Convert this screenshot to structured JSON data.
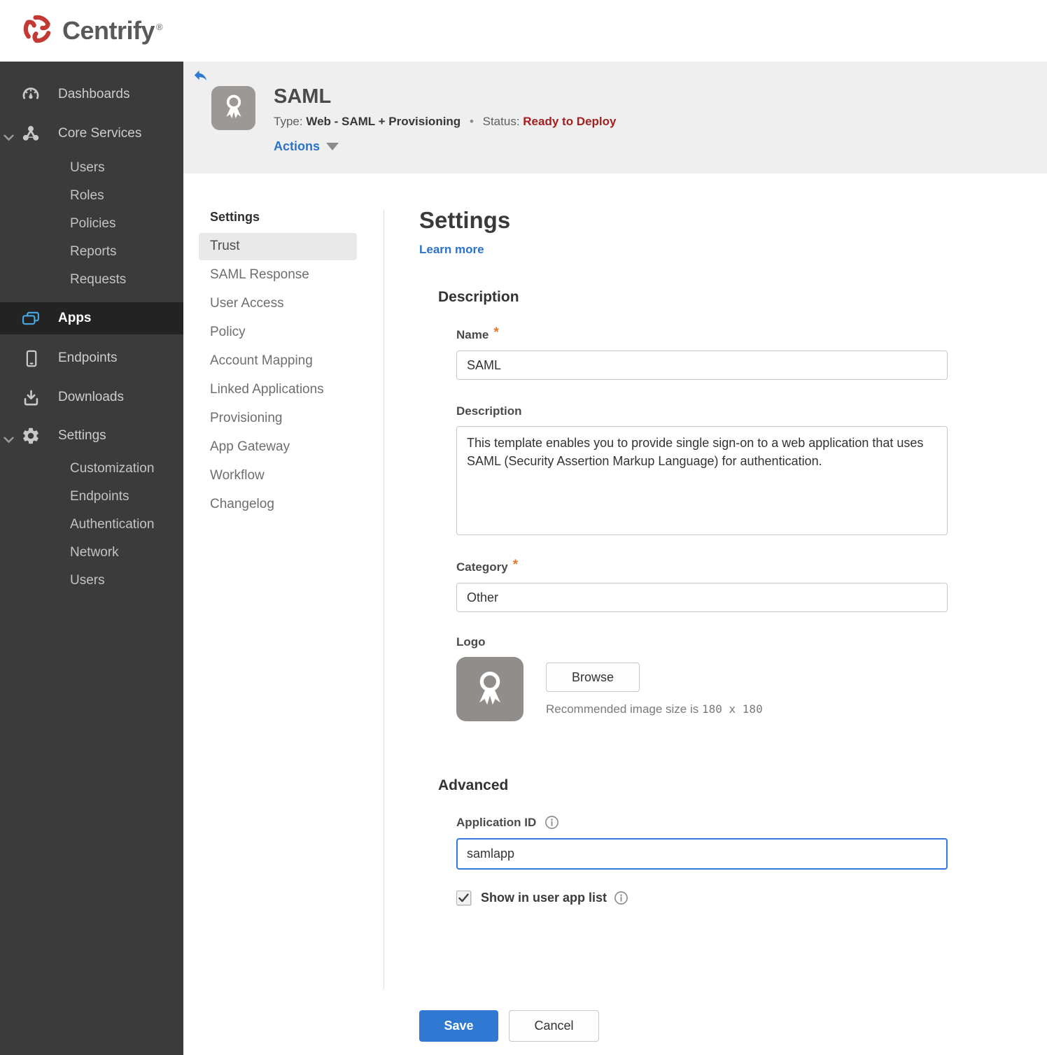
{
  "brand": {
    "name": "Centrify",
    "registered": "®"
  },
  "sidebar": {
    "dashboards": "Dashboards",
    "core_services": "Core Services",
    "core_children": [
      "Users",
      "Roles",
      "Policies",
      "Reports",
      "Requests"
    ],
    "apps": "Apps",
    "endpoints": "Endpoints",
    "downloads": "Downloads",
    "settings": "Settings",
    "settings_children": [
      "Customization",
      "Endpoints",
      "Authentication",
      "Network",
      "Users"
    ]
  },
  "header": {
    "app_name": "SAML",
    "type_label": "Type:",
    "type_value": "Web - SAML + Provisioning",
    "separator": "•",
    "status_label": "Status:",
    "status_value": "Ready to Deploy",
    "actions_label": "Actions"
  },
  "subnav": {
    "title": "Settings",
    "active_item": "Trust",
    "items": [
      "Trust",
      "SAML Response",
      "User Access",
      "Policy",
      "Account Mapping",
      "Linked Applications",
      "Provisioning",
      "App Gateway",
      "Workflow",
      "Changelog"
    ]
  },
  "main": {
    "title": "Settings",
    "learn_more": "Learn more",
    "required_marker": "*",
    "description_heading": "Description",
    "name_label": "Name",
    "name_value": "SAML",
    "description_label": "Description",
    "description_value": "This template enables you to provide single sign-on to a web application that uses SAML (Security Assertion Markup Language) for authentication.",
    "category_label": "Category",
    "category_value": "Other",
    "logo_label": "Logo",
    "browse_label": "Browse",
    "logo_hint_prefix": "Recommended image size is",
    "logo_hint_size": "180 x 180",
    "advanced_heading": "Advanced",
    "app_id_label": "Application ID",
    "app_id_value": "samlapp",
    "show_in_list_label": "Show in user app list",
    "show_in_list_checked": true,
    "save_label": "Save",
    "cancel_label": "Cancel"
  },
  "icons": {
    "centrify-swirl-icon": "red tri-arc swirl",
    "gauge-icon": "speedometer",
    "core-services-icon": "three-node cluster",
    "apps-icon": "stacked cards (blue)",
    "smartphone-icon": "phone outline",
    "download-icon": "arrow into tray",
    "gear-icon": "settings gear",
    "chevron-down-icon": "expand chevron",
    "back-arrow-icon": "blue reply arrow",
    "ribbon-award-icon": "white rosette ribbon",
    "info-icon": "circled i",
    "caret-down-icon": "gray triangle",
    "checkmark-icon": "dark check"
  },
  "colors": {
    "accent_blue": "#2f79d2",
    "link_blue": "#2b72cd",
    "status_red": "#a32020",
    "required_orange": "#e8752a",
    "sidebar_bg": "#3b3b3b",
    "active_row_bg": "#232323",
    "apps_icon_blue": "#45a8e3",
    "header_bg": "#efefef",
    "brand_red": "#c23a32"
  }
}
